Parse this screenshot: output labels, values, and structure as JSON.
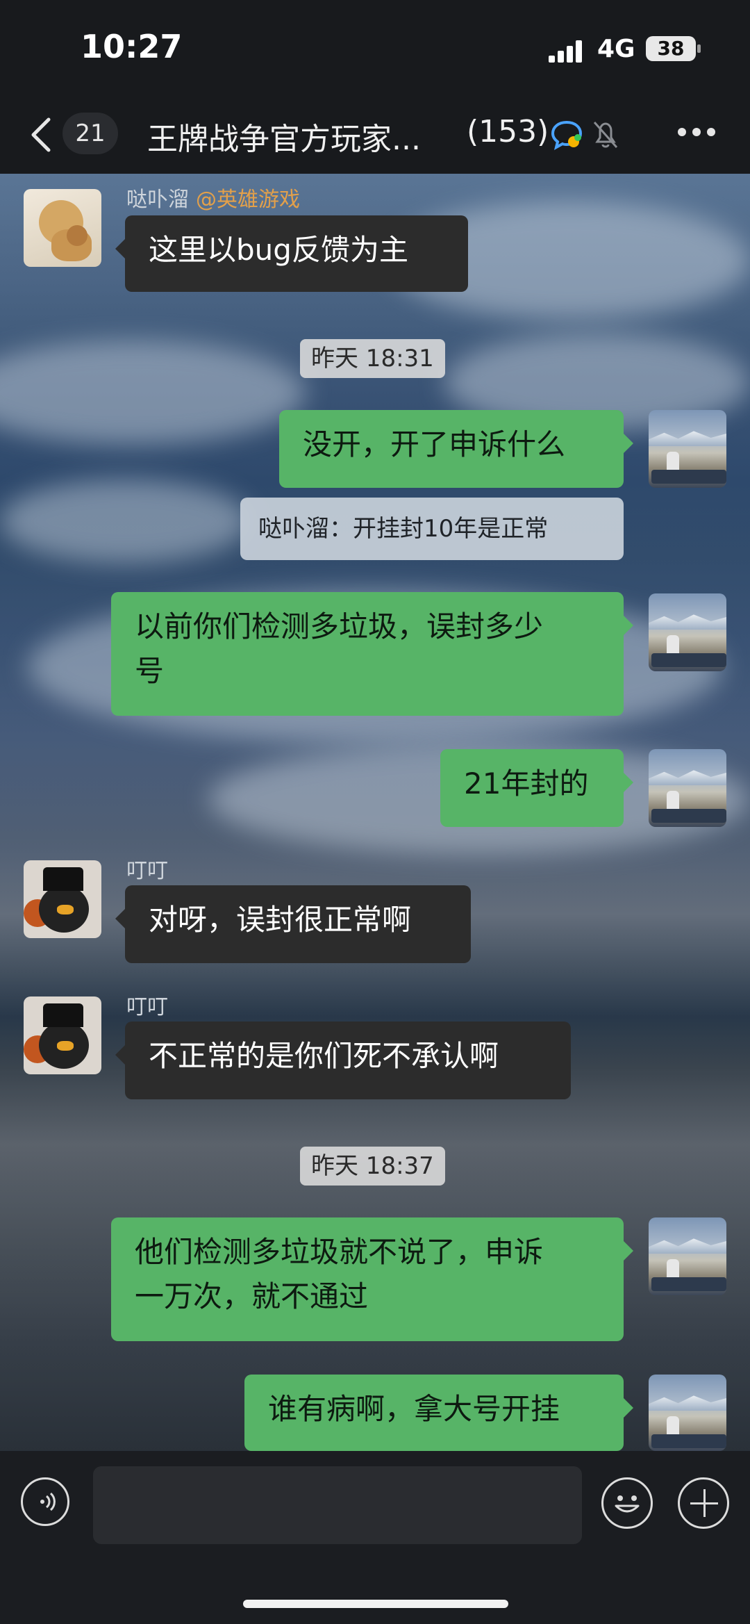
{
  "status": {
    "time": "10:27",
    "network": "4G",
    "battery": "38"
  },
  "header": {
    "back_count": "21",
    "title": "王牌战争官方玩家...",
    "member_count": "(153)"
  },
  "messages": [
    {
      "sender": "哒卟溜",
      "tag": "@英雄游戏",
      "text": "这里以bug反馈为主"
    },
    {
      "timestamp": "昨天 18:31"
    },
    {
      "text": "没开，开了申诉什么"
    },
    {
      "quote": "哒卟溜：开挂封10年是正常"
    },
    {
      "text_line1": "以前你们检测多垃圾，误封多少",
      "text_line2": "号"
    },
    {
      "text": "21年封的"
    },
    {
      "sender": "叮叮",
      "text": "对呀，误封很正常啊"
    },
    {
      "sender": "叮叮",
      "text": "不正常的是你们死不承认啊"
    },
    {
      "timestamp": "昨天 18:37"
    },
    {
      "text_line1": "他们检测多垃圾就不说了，申诉",
      "text_line2": "一万次，就不通过"
    },
    {
      "text": "谁有病啊，拿大号开挂"
    }
  ],
  "input": {
    "placeholder": ""
  },
  "colors": {
    "bubble_green": "#57b467",
    "bubble_gray": "#2c2c2c",
    "tag": "#e3a04a"
  }
}
